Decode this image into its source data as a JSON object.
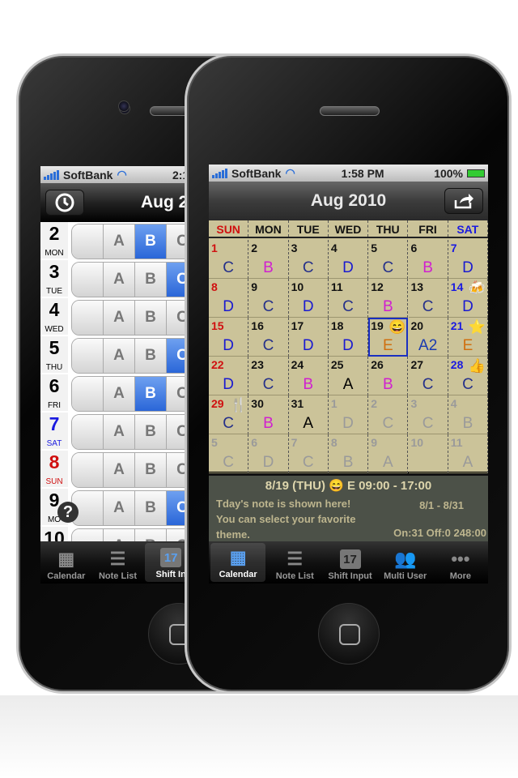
{
  "left": {
    "status": {
      "carrier": "SoftBank",
      "time": "2:16"
    },
    "nav": {
      "title": "Aug 2",
      "clock_icon": "clock-icon"
    },
    "rows": [
      {
        "num": "2",
        "dow": "MON",
        "color": "#000",
        "sel": "B"
      },
      {
        "num": "3",
        "dow": "TUE",
        "color": "#000",
        "sel": "C"
      },
      {
        "num": "4",
        "dow": "WED",
        "color": "#000",
        "sel": ""
      },
      {
        "num": "5",
        "dow": "THU",
        "color": "#000",
        "sel": "C"
      },
      {
        "num": "6",
        "dow": "FRI",
        "color": "#000",
        "sel": "B"
      },
      {
        "num": "7",
        "dow": "SAT",
        "color": "#1a1ae0",
        "sel": ""
      },
      {
        "num": "8",
        "dow": "SUN",
        "color": "#d01010",
        "sel": ""
      },
      {
        "num": "9",
        "dow": "MO",
        "color": "#000",
        "sel": "C"
      },
      {
        "num": "10",
        "dow": "",
        "color": "#000",
        "sel": ""
      }
    ],
    "segments": [
      "",
      "A",
      "B",
      "C"
    ],
    "help_icon": "question-icon",
    "tabs": [
      {
        "label": "Calendar",
        "icon": "calendar-icon"
      },
      {
        "label": "Note List",
        "icon": "list-icon"
      },
      {
        "label": "Shift In",
        "icon": "shift-input-icon",
        "active": true
      }
    ]
  },
  "right": {
    "status": {
      "carrier": "SoftBank",
      "time": "1:58 PM",
      "battery": "100%"
    },
    "nav": {
      "title": "Aug 2010",
      "share_icon": "share-icon"
    },
    "weekdays": [
      {
        "l": "SUN",
        "c": "#d01010"
      },
      {
        "l": "MON",
        "c": "#111"
      },
      {
        "l": "TUE",
        "c": "#111"
      },
      {
        "l": "WED",
        "c": "#111"
      },
      {
        "l": "THU",
        "c": "#111"
      },
      {
        "l": "FRI",
        "c": "#111"
      },
      {
        "l": "SAT",
        "c": "#1a1ae0"
      }
    ],
    "shift_colors": {
      "A": "#000000",
      "B": "#d020d0",
      "C": "#25308a",
      "D": "#1a1ad0",
      "E": "#d07010",
      "A2": "#1a3ab0",
      "dim": "#9a9a9a"
    },
    "cells": [
      {
        "d": "1",
        "s": "C"
      },
      {
        "d": "2",
        "s": "B"
      },
      {
        "d": "3",
        "s": "C"
      },
      {
        "d": "4",
        "s": "D"
      },
      {
        "d": "5",
        "s": "C"
      },
      {
        "d": "6",
        "s": "B"
      },
      {
        "d": "7",
        "s": "D"
      },
      {
        "d": "8",
        "s": "D"
      },
      {
        "d": "9",
        "s": "C"
      },
      {
        "d": "10",
        "s": "D"
      },
      {
        "d": "11",
        "s": "C"
      },
      {
        "d": "12",
        "s": "B"
      },
      {
        "d": "13",
        "s": "C"
      },
      {
        "d": "14",
        "s": "D",
        "icon": "🍻",
        "iconName": "beer-icon"
      },
      {
        "d": "15",
        "s": "D"
      },
      {
        "d": "16",
        "s": "C"
      },
      {
        "d": "17",
        "s": "D"
      },
      {
        "d": "18",
        "s": "D"
      },
      {
        "d": "19",
        "s": "E",
        "icon": "😄",
        "iconName": "smile-icon",
        "selected": true
      },
      {
        "d": "20",
        "s": "A2"
      },
      {
        "d": "21",
        "s": "E",
        "icon": "⭐",
        "iconName": "star-icon"
      },
      {
        "d": "22",
        "s": "D"
      },
      {
        "d": "23",
        "s": "C"
      },
      {
        "d": "24",
        "s": "B"
      },
      {
        "d": "25",
        "s": "A"
      },
      {
        "d": "26",
        "s": "B"
      },
      {
        "d": "27",
        "s": "C"
      },
      {
        "d": "28",
        "s": "C",
        "icon": "👍",
        "iconName": "thumbs-up-icon"
      },
      {
        "d": "29",
        "s": "C",
        "icon": "🍴",
        "iconName": "fork-knife-icon"
      },
      {
        "d": "30",
        "s": "B"
      },
      {
        "d": "31",
        "s": "A"
      },
      {
        "d": "1",
        "s": "D",
        "dim": true
      },
      {
        "d": "2",
        "s": "C",
        "dim": true
      },
      {
        "d": "3",
        "s": "C",
        "dim": true
      },
      {
        "d": "4",
        "s": "B",
        "dim": true
      },
      {
        "d": "5",
        "s": "C",
        "dim": true
      },
      {
        "d": "6",
        "s": "D",
        "dim": true
      },
      {
        "d": "7",
        "s": "C",
        "dim": true
      },
      {
        "d": "8",
        "s": "B",
        "dim": true
      },
      {
        "d": "9",
        "s": "A",
        "dim": true
      },
      {
        "d": "10",
        "s": "",
        "dim": true
      },
      {
        "d": "11",
        "s": "A",
        "dim": true
      }
    ],
    "note": {
      "date": "8/19 (THU)",
      "shift": "E 09:00 - 17:00",
      "text": "Tday's note is shown here! You can select your favorite theme.",
      "range": "8/1 - 8/31",
      "summary": "On:31 Off:0 248:00"
    },
    "tabs": [
      {
        "label": "Calendar",
        "icon": "calendar-icon",
        "active": true
      },
      {
        "label": "Note List",
        "icon": "list-icon"
      },
      {
        "label": "Shift Input",
        "icon": "shift-input-icon"
      },
      {
        "label": "Multi User",
        "icon": "users-icon"
      },
      {
        "label": "More",
        "icon": "more-icon"
      }
    ]
  }
}
